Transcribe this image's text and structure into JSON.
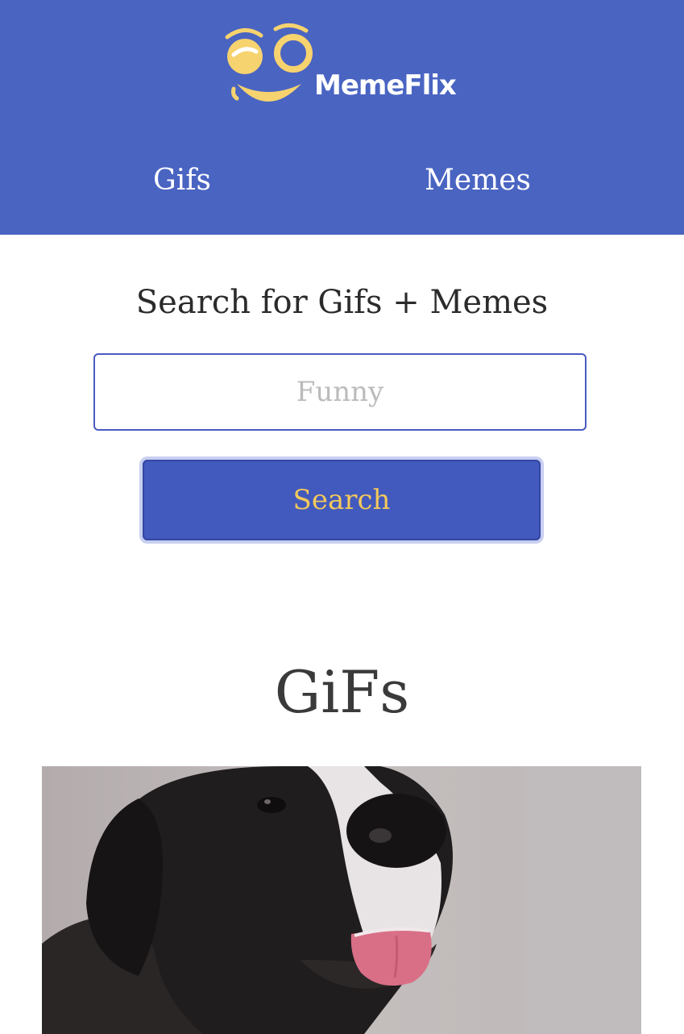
{
  "app": {
    "brand_name": "MemeFlix",
    "colors": {
      "header_bg": "#4a64c2",
      "button_bg": "#4259bd",
      "button_text": "#f3c85c",
      "logo_yellow": "#f6d36e"
    }
  },
  "nav": {
    "items": [
      {
        "label": "Gifs"
      },
      {
        "label": "Memes"
      }
    ]
  },
  "search": {
    "title": "Search for Gifs + Memes",
    "input_value": "",
    "placeholder": "Funny",
    "button_label": "Search"
  },
  "results": {
    "section_title": "GiFs",
    "items": [
      {
        "type": "gif",
        "subject": "dog sticking out tongue"
      }
    ]
  }
}
